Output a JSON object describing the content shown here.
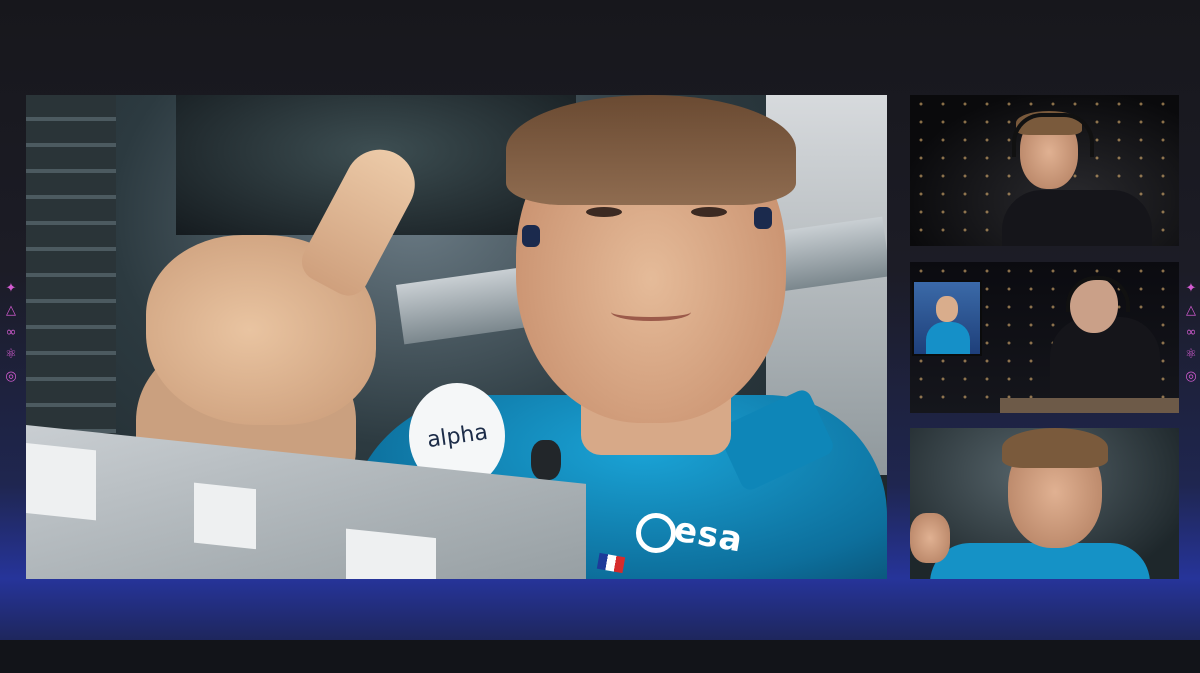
{
  "main_video": {
    "patch_text": "alpha",
    "logo_text": "esa"
  },
  "side_icons": [
    {
      "name": "sparkle-icon",
      "glyph": "✦"
    },
    {
      "name": "triangle-icon",
      "glyph": "△"
    },
    {
      "name": "infinity-icon",
      "glyph": "∞"
    },
    {
      "name": "atom-icon",
      "glyph": "⚛"
    },
    {
      "name": "spiral-icon",
      "glyph": "◎"
    }
  ],
  "colors": {
    "icon_accent": "#d25bd0",
    "shirt_blue": "#1aa3d6",
    "background_band": "#26349a"
  }
}
